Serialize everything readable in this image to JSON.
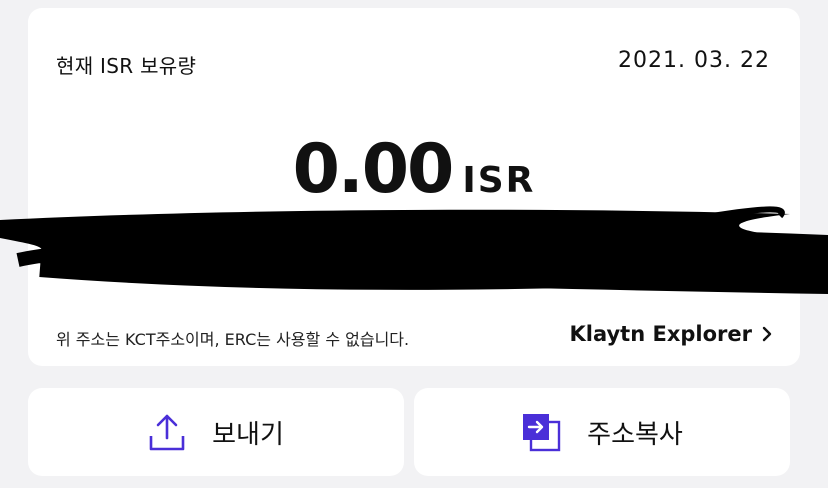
{
  "card": {
    "title": "현재 ISR 보유량",
    "date": "2021. 03. 22",
    "balance": "0.00",
    "unit": "ISR",
    "notice": "위 주소는 KCT주소이며, ERC는 사용할 수 없습니다.",
    "explorer_link": "Klaytn Explorer",
    "explorer_icon": "chevron-right-icon"
  },
  "actions": {
    "send_label": "보내기",
    "send_icon": "upload-icon",
    "copy_label": "주소복사",
    "copy_icon": "copy-icon"
  },
  "colors": {
    "background": "#f2f2f4",
    "card": "#ffffff",
    "accent": "#4a2fd8",
    "redaction": "#000000"
  }
}
